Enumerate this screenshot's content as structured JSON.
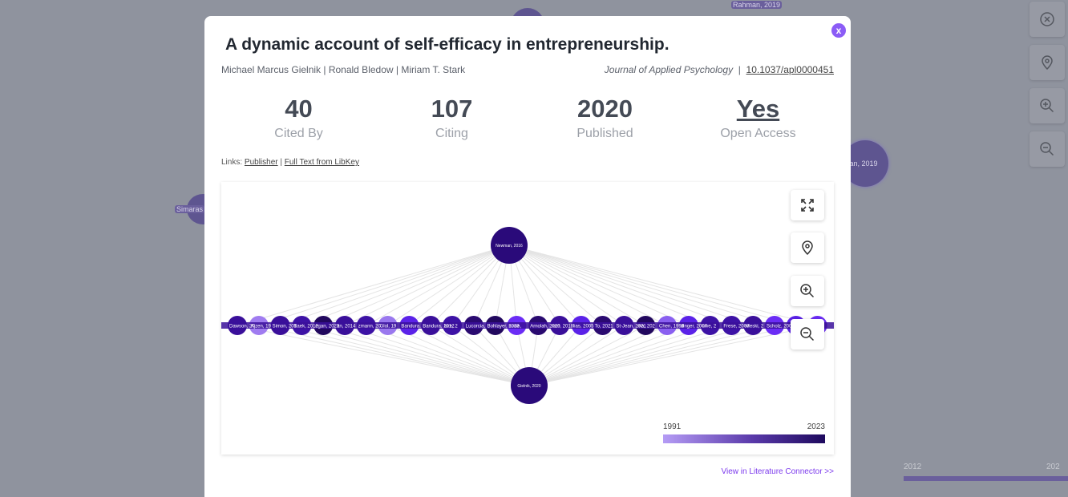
{
  "background": {
    "labels": [
      "Rahman, 2019",
      "Rahman, 2019",
      "Simaras"
    ],
    "timeline": {
      "start": "2012",
      "end": "202"
    }
  },
  "side_controls": [
    "close-circle-icon",
    "location-pin-icon",
    "zoom-in-icon",
    "zoom-out-icon"
  ],
  "modal": {
    "close_label": "x",
    "title": "A dynamic account of self-efficacy in entrepreneurship.",
    "authors": "Michael Marcus Gielnik | Ronald Bledow | Miriam T. Stark",
    "journal": "Journal of Applied Psychology",
    "doi": "10.1037/apl0000451",
    "stats": [
      {
        "value": "40",
        "label": "Cited By"
      },
      {
        "value": "107",
        "label": "Citing"
      },
      {
        "value": "2020",
        "label": "Published"
      },
      {
        "value": "Yes",
        "label": "Open Access"
      }
    ],
    "links_label": "Links:",
    "links": [
      "Publisher",
      "Full Text from LibKey"
    ],
    "view_link": "View in Literature Connector >>"
  },
  "graph": {
    "top_node": {
      "label": "Newman, 2016",
      "color": "#2a0a7a"
    },
    "bottom_node": {
      "label": "Gielnik, 2020",
      "color": "#2a0a7a"
    },
    "nodes": [
      {
        "label": "Dawson, 20",
        "color": "#3a0f9a"
      },
      {
        "label": "Ajzen, 19",
        "color": "#a07cf0"
      },
      {
        "label": "Simon, 201",
        "color": "#3a0f9a"
      },
      {
        "label": "Baek, 2012",
        "color": "#3d12a5"
      },
      {
        "label": "egan, 2023",
        "color": "#22085e"
      },
      {
        "label": "an, 2014",
        "color": "#3a0f9a"
      },
      {
        "label": "zmann, 20",
        "color": "#3d12a5"
      },
      {
        "label": "Glol, 19",
        "color": "#9a78ee"
      },
      {
        "label": "Bandura, ",
        "color": "#5b22e8"
      },
      {
        "label": "Bandura, 2012",
        "color": "#3a0f9a"
      },
      {
        "label": "lore, 2",
        "color": "#3d12a5"
      },
      {
        "label": "Lucorcia, ",
        "color": "#2a0a70"
      },
      {
        "label": "Bohlayer, 2023",
        "color": "#22085e"
      },
      {
        "label": "suwe, ",
        "color": "#6b2cf5"
      },
      {
        "label": "Arnolah, 2020",
        "color": "#2a0a70"
      },
      {
        "label": "rom, 2018",
        "color": "#3a0f9a"
      },
      {
        "label": "lias, 2005",
        "color": "#5b22e8"
      },
      {
        "label": "To, 2021",
        "color": "#2a0a70"
      },
      {
        "label": "St-Jean, 2021",
        "color": "#3a0f9a"
      },
      {
        "label": "ma, 202",
        "color": "#22085e"
      },
      {
        "label": "Chen, 1998",
        "color": "#8a60f0"
      },
      {
        "label": "dinger, 2007",
        "color": "#5b22e8"
      },
      {
        "label": "uwe, 2",
        "color": "#3d12a5"
      },
      {
        "label": "Frese, 2009",
        "color": "#3d12a5"
      },
      {
        "label": "wleski, 2",
        "color": "#3a0f9a"
      },
      {
        "label": "Scholz, 2002",
        "color": "#6b2cf5"
      },
      {
        "label": "",
        "color": "#5b22e8"
      },
      {
        "label": "20",
        "color": "#6b2cf5"
      }
    ],
    "controls": [
      "fullscreen-icon",
      "location-pin-icon",
      "zoom-in-icon",
      "zoom-out-icon"
    ],
    "legend": {
      "min": "1991",
      "max": "2023",
      "colors": [
        "#b59cf5",
        "#1e0a5e"
      ]
    }
  }
}
